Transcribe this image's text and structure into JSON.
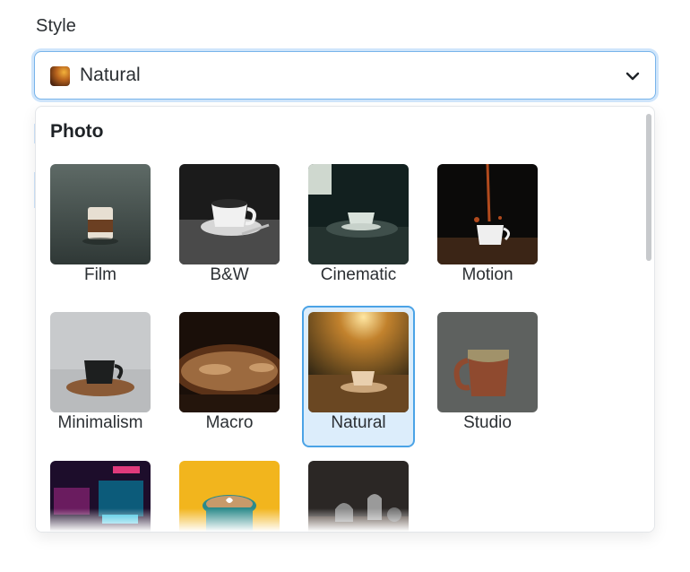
{
  "field": {
    "label": "Style",
    "selected": "Natural",
    "thumb_icon": "natural-style-thumbnail",
    "chevron_icon": "chevron-down-icon"
  },
  "dropdown": {
    "group": "Photo",
    "options": [
      {
        "label": "Film",
        "selected": false
      },
      {
        "label": "B&W",
        "selected": false
      },
      {
        "label": "Cinematic",
        "selected": false
      },
      {
        "label": "Motion",
        "selected": false
      },
      {
        "label": "Minimalism",
        "selected": false
      },
      {
        "label": "Macro",
        "selected": false
      },
      {
        "label": "Natural",
        "selected": true
      },
      {
        "label": "Studio",
        "selected": false
      },
      {
        "label": "",
        "selected": false
      },
      {
        "label": "",
        "selected": false
      },
      {
        "label": "",
        "selected": false
      }
    ]
  },
  "colors": {
    "accent": "#4ba3e6",
    "selected_bg": "#dcedfb",
    "focus_ring": "#cfe5fb"
  }
}
